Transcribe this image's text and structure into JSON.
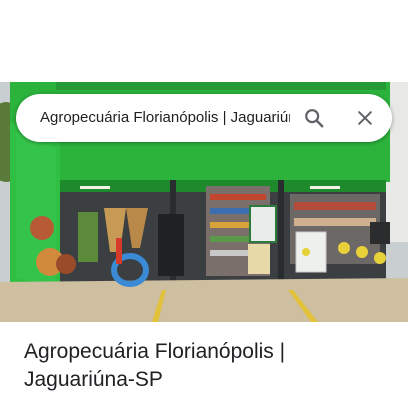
{
  "search": {
    "query": "Agropecuária Florianópolis | Jaguariúna-SP"
  },
  "place": {
    "title": "Agropecuária Florianópolis | Jaguariúna-SP"
  },
  "icons": {
    "search": "search-icon",
    "close": "close-icon"
  },
  "colors": {
    "storefront_green": "#27b53a",
    "icon_gray": "#5f6368",
    "text": "#202124"
  }
}
